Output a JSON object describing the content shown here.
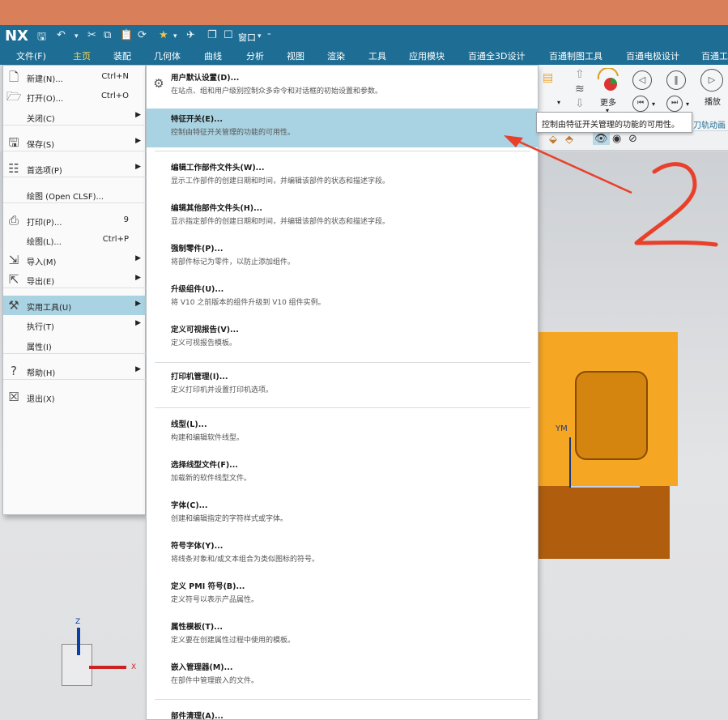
{
  "app": {
    "logo": "NX",
    "window_menu": "窗口"
  },
  "ribbon_tabs": [
    {
      "label": "文件(F)",
      "active": false
    },
    {
      "label": "主页",
      "active": true
    },
    {
      "label": "装配",
      "active": false
    },
    {
      "label": "几何体",
      "active": false
    },
    {
      "label": "曲线",
      "active": false
    },
    {
      "label": "分析",
      "active": false
    },
    {
      "label": "视图",
      "active": false
    },
    {
      "label": "渲染",
      "active": false
    },
    {
      "label": "工具",
      "active": false
    },
    {
      "label": "应用模块",
      "active": false
    },
    {
      "label": "百通全3D设计",
      "active": false
    },
    {
      "label": "百通制图工具",
      "active": false
    },
    {
      "label": "百通电极设计",
      "active": false
    },
    {
      "label": "百通工",
      "active": false
    }
  ],
  "ribbon": {
    "more_label": "更多",
    "play_label": "播放",
    "toolpath_label": "刀轨动画"
  },
  "file_menu": {
    "items": [
      {
        "label": "新建(N)...",
        "shortcut": "Ctrl+N",
        "icon": "new-file-icon",
        "glyph": "🗋",
        "arrow": false
      },
      {
        "label": "打开(O)...",
        "shortcut": "Ctrl+O",
        "icon": "open-folder-icon",
        "glyph": "🗁",
        "arrow": false
      },
      {
        "label": "关闭(C)",
        "shortcut": "",
        "icon": "",
        "glyph": "",
        "arrow": true
      },
      {
        "label": "保存(S)",
        "shortcut": "",
        "icon": "save-icon",
        "glyph": "🖫",
        "arrow": true
      },
      {
        "label": "首选项(P)",
        "shortcut": "",
        "icon": "preferences-icon",
        "glyph": "☷",
        "arrow": true
      },
      {
        "label": "绘图 (Open CLSF)...",
        "shortcut": "",
        "icon": "",
        "glyph": "",
        "arrow": false
      },
      {
        "label": "打印(P)...",
        "shortcut": "9",
        "icon": "printer-icon",
        "glyph": "⎙",
        "arrow": false
      },
      {
        "label": "绘图(L)...",
        "shortcut": "Ctrl+P",
        "icon": "",
        "glyph": "",
        "arrow": false
      },
      {
        "label": "导入(M)",
        "shortcut": "",
        "icon": "import-icon",
        "glyph": "⇲",
        "arrow": true
      },
      {
        "label": "导出(E)",
        "shortcut": "",
        "icon": "export-icon",
        "glyph": "⇱",
        "arrow": true
      },
      {
        "label": "实用工具(U)",
        "shortcut": "",
        "icon": "utilities-tools-icon",
        "glyph": "⚒",
        "arrow": true
      },
      {
        "label": "执行(T)",
        "shortcut": "",
        "icon": "",
        "glyph": "",
        "arrow": true
      },
      {
        "label": "属性(I)",
        "shortcut": "",
        "icon": "",
        "glyph": "",
        "arrow": false
      },
      {
        "label": "帮助(H)",
        "shortcut": "",
        "icon": "help-icon",
        "glyph": "?",
        "arrow": true
      },
      {
        "label": "退出(X)",
        "shortcut": "",
        "icon": "exit-icon",
        "glyph": "☒",
        "arrow": false
      }
    ]
  },
  "sub_menu": {
    "items": [
      {
        "title": "用户默认设置(D)...",
        "desc": "在站点、组和用户级别控制众多命令和对话框的初始设置和参数。"
      },
      {
        "title": "特征开关(E)...",
        "desc": "控制由特征开关管理的功能的可用性。"
      },
      {
        "title": "编辑工作部件文件头(W)...",
        "desc": "显示工作部件的创建日期和时间，并编辑该部件的状态和描述字段。"
      },
      {
        "title": "编辑其他部件文件头(H)...",
        "desc": "显示指定部件的创建日期和时间，并编辑该部件的状态和描述字段。"
      },
      {
        "title": "强制零件(P)...",
        "desc": "将部件标记为零件，以防止添加组件。"
      },
      {
        "title": "升级组件(U)...",
        "desc": "将 V10 之前版本的组件升级到 V10 组件实例。"
      },
      {
        "title": "定义可视报告(V)...",
        "desc": "定义可视报告模板。"
      },
      {
        "title": "打印机管理(I)...",
        "desc": "定义打印机并设置打印机选项。"
      },
      {
        "title": "线型(L)...",
        "desc": "构建和编辑软件线型。"
      },
      {
        "title": "选择线型文件(F)...",
        "desc": "加载新的软件线型文件。"
      },
      {
        "title": "字体(C)...",
        "desc": "创建和编辑指定的字符样式或字体。"
      },
      {
        "title": "符号字体(Y)...",
        "desc": "将线条对象和/或文本组合为类似图标的符号。"
      },
      {
        "title": "定义 PMI 符号(B)...",
        "desc": "定义符号以表示产品属性。"
      },
      {
        "title": "属性模板(T)...",
        "desc": "定义要在创建属性过程中使用的模板。"
      },
      {
        "title": "嵌入管理器(M)...",
        "desc": "在部件中管理嵌入的文件。"
      },
      {
        "title": "部件清理(A)...",
        "desc": ""
      }
    ]
  },
  "tooltip": {
    "text": "控制由特征开关管理的功能的可用性。"
  },
  "viewport": {
    "part_axis_label": "YM",
    "triad_z": "Z",
    "triad_x": "X"
  },
  "annotation": {
    "handwritten": "2",
    "color": "#e8402a"
  },
  "colors": {
    "titlebar": "#1d6d94",
    "highlight": "#a9d3e2",
    "accent_tab": "#ffd64a",
    "part": "#f5a623"
  }
}
